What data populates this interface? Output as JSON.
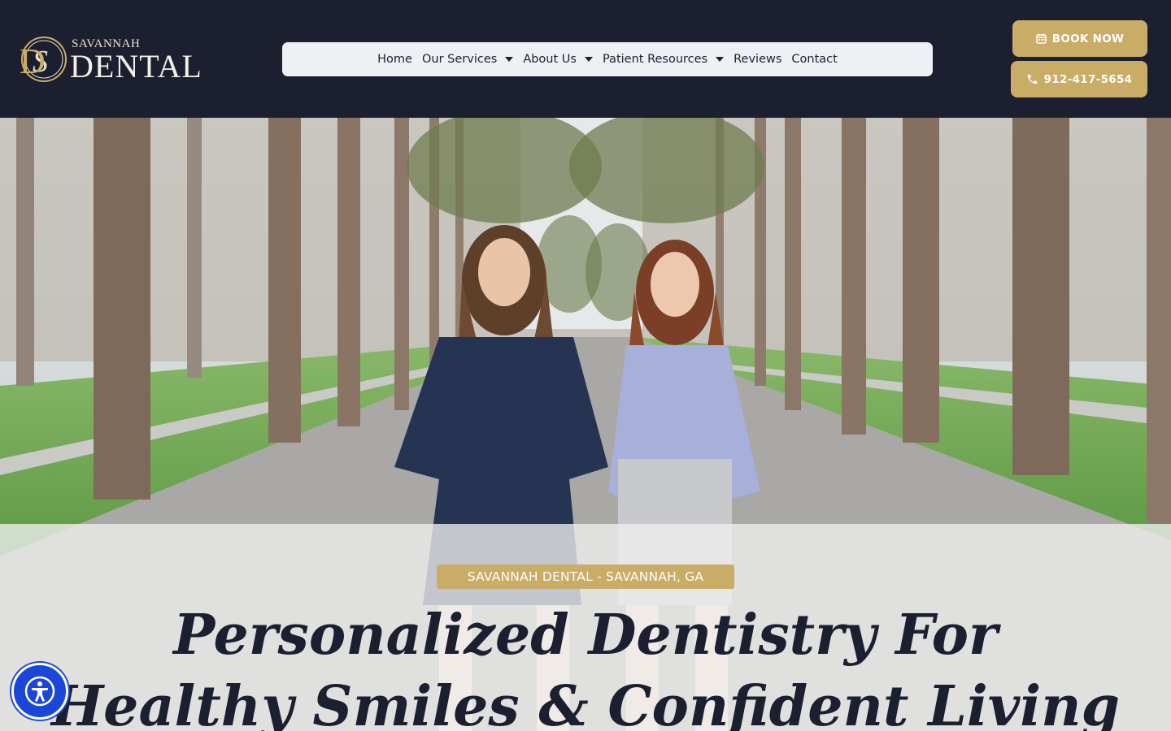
{
  "header": {
    "logo": {
      "monogram": "SD",
      "name_small": "SAVANNAH",
      "name_large": "DENTAL"
    },
    "nav": [
      {
        "label": "Home",
        "has_dropdown": false
      },
      {
        "label": "Our Services",
        "has_dropdown": true
      },
      {
        "label": "About Us",
        "has_dropdown": true
      },
      {
        "label": "Patient Resources",
        "has_dropdown": true
      },
      {
        "label": "Reviews",
        "has_dropdown": false
      },
      {
        "label": "Contact",
        "has_dropdown": false
      }
    ],
    "book_button": {
      "label": "BOOK NOW",
      "icon": "calendar-icon"
    },
    "phone_button": {
      "label": "912-417-5654",
      "icon": "phone-icon"
    }
  },
  "hero": {
    "badge": "SAVANNAH DENTAL - SAVANNAH, GA",
    "headline_line1": "Personalized Dentistry For",
    "headline_line2": "Healthy Smiles & Confident Living"
  },
  "accessibility": {
    "icon": "accessibility-icon"
  },
  "colors": {
    "header_bg": "#1c1f30",
    "accent_gold": "#c9ad66",
    "nav_bg": "#eef0f4",
    "accessibility_blue": "#1a47d8"
  }
}
